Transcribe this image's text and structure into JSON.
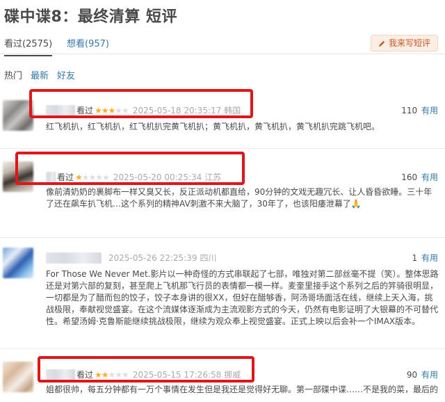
{
  "title": "碟中谍8：最终清算 短评",
  "tabs": [
    {
      "label": "看过(2575)"
    },
    {
      "label": "想看(957)"
    }
  ],
  "write_button": {
    "icon": "pencil-icon",
    "label": "我来写短评"
  },
  "sorts": [
    {
      "label": "热门"
    },
    {
      "label": "最新"
    },
    {
      "label": "好友"
    }
  ],
  "colors": {
    "highlight_box": "#e0161b",
    "star": "#ffac2d",
    "link": "#3377aa"
  },
  "reviews": [
    {
      "status": "看过",
      "rating": 3,
      "time": "2025-05-18 20:35:17",
      "location": "韩国",
      "useful_count": "110",
      "useful_label": "有用",
      "content": "红飞机扒，红飞机扒，红飞机扒完黄飞机扒；黄飞机扒，黄飞机扒，黄飞机扒完跳飞机吧。"
    },
    {
      "status": "看过",
      "rating": 1,
      "time": "2025-05-20 00:25:34",
      "location": "江苏",
      "useful_count": "160",
      "useful_label": "有用",
      "content": "像前清奶奶的裹脚布一样又臭又长，反正派动机都直给，90分钟的文戏无趣冗长、让人昏昏欲睡。三十年了还在飙车扒飞机…这个系列的精神AV刺激不来大脑了，30年了，也该阳痿泄幕了🙏"
    },
    {
      "status": "",
      "rating": 0,
      "time": "2025-05-26 22:25:39",
      "location": "四川",
      "useful_count": "1",
      "useful_label": "有用",
      "content": "For Those We Never Met.影片以一种奇怪的方式串联起了七部，唯独对第二部丝毫不提（笑）。整体思路还是对第六部的复刻，甚至爬上飞机那飞行员的表情都一模一样。麦奎里接手这个系列之后的笄骑很明显，一切都是为了醋而包的饺子，饺子本身讲的很XX，但好在醋够香，阿汤哥场面活在线，继续上天入海，挑战极限，奉献视觉盛宴。在这个流媒体逐渐成为主流观影方式的今天，仍然有电影证明了大银幕的不可替代性。希望汤姆·克鲁斯能继续挑战极限，继续为观众奉上视觉盛宴。正式上映以后会补一个IMAX版本。"
    },
    {
      "status": "看过",
      "rating": 2,
      "time": "2025-05-15 17:26:58",
      "location": "挪威",
      "useful_count": "90",
      "useful_label": "有用",
      "content": "姐都很帅，每五分钟都有一万个事情在发生但是我还是觉得好无聊。第一部碟中谍……不是我的菜，最后的"
    }
  ]
}
